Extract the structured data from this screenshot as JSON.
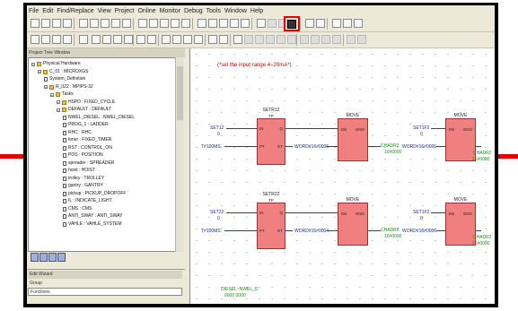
{
  "menubar": {
    "items": [
      "File",
      "Edit",
      "Find/Replace",
      "View",
      "Project",
      "Online",
      "Monitor",
      "Debug",
      "Tools",
      "Window",
      "Help"
    ]
  },
  "toolbar_icons": [
    "new-icon",
    "open-icon",
    "save-icon",
    "print-icon",
    "cut-icon",
    "copy-icon",
    "paste-icon",
    "undo-icon",
    "redo-icon",
    "find-icon",
    "zoom-in-icon",
    "zoom-out-icon",
    "monitor-icon",
    "compile-icon",
    "connect-icon",
    "disconnect-icon",
    "highlighted-tool-icon",
    "stop-icon",
    "run-icon"
  ],
  "tree_panel": {
    "title": "Project Tree Window",
    "items": [
      {
        "label": "Physical Hardware",
        "level": 0,
        "kind": "folder"
      },
      {
        "label": "C_01 : MICROXGS",
        "level": 1,
        "kind": "folder"
      },
      {
        "label": "System_Definition",
        "level": 2,
        "kind": "file"
      },
      {
        "label": "R_022 : MPIPS-32",
        "level": 2,
        "kind": "folder"
      },
      {
        "label": "Tasks",
        "level": 3,
        "kind": "folder"
      },
      {
        "label": "HSPD : FIXED_CYCLE",
        "level": 4,
        "kind": "folder"
      },
      {
        "label": "DEFAULT : DEFAULT",
        "level": 4,
        "kind": "folder"
      },
      {
        "label": "NWEL_DIESEL : NWEL_DIESEL",
        "level": 5,
        "kind": "file"
      },
      {
        "label": "PROG_1 : LADDER",
        "level": 5,
        "kind": "file"
      },
      {
        "label": "RHC : RHC",
        "level": 5,
        "kind": "file"
      },
      {
        "label": "timer : FIXED_TIMER",
        "level": 5,
        "kind": "file"
      },
      {
        "label": "RST : CONTROL_ON",
        "level": 5,
        "kind": "file"
      },
      {
        "label": "POS : POSITION",
        "level": 5,
        "kind": "file"
      },
      {
        "label": "spreader : SPREADER",
        "level": 5,
        "kind": "file"
      },
      {
        "label": "hoist : HOIST",
        "level": 5,
        "kind": "file"
      },
      {
        "label": "trolley : TROLLEY",
        "level": 5,
        "kind": "file"
      },
      {
        "label": "gantry : GANTRY",
        "level": 5,
        "kind": "file"
      },
      {
        "label": "pickup : PICKUP_DROPOFF",
        "level": 5,
        "kind": "file"
      },
      {
        "label": "IL : INDICATE_LIGHT",
        "level": 5,
        "kind": "file"
      },
      {
        "label": "CMS : CMS",
        "level": 5,
        "kind": "file"
      },
      {
        "label": "ANTI_SWAY : ANTI_SWAY",
        "level": 5,
        "kind": "file"
      },
      {
        "label": "VAHLE : VAHLE_SYSTEM",
        "level": 5,
        "kind": "file"
      }
    ]
  },
  "edit_wizard": {
    "title": "Edit Wizard",
    "group_label": "Group",
    "group_value": "Functions"
  },
  "editor": {
    "comment": "(*set the input range 4~20mA*)",
    "rungs": [
      {
        "tp": {
          "title": "SETR12",
          "type": "TP",
          "pin_in": "IN",
          "pin_q": "Q",
          "pin_pt": "PT",
          "pin_et": "ET"
        },
        "in_var": "SET12",
        "in_val": "0",
        "pt_var": "T#100MS",
        "word_mid": "WORD#16#0006",
        "mv1": {
          "title": "MOVE",
          "pin_en": "EN",
          "pin_eno": "ENO"
        },
        "out1_var": "CHADR2",
        "out1_val": "16#0000",
        "in2_var": "SET1F2",
        "in2_val": "0",
        "word_right": "WORD#16#0006",
        "mv2": {
          "title": "MOVE",
          "pin_en": "EN",
          "pin_eno": "ENO"
        },
        "out2_var": "CHADR2",
        "out2_val": "16#0000"
      },
      {
        "tp": {
          "title": "SETR22",
          "type": "TP",
          "pin_in": "IN",
          "pin_q": "Q",
          "pin_pt": "PT",
          "pin_et": "ET"
        },
        "in_var": "SET22",
        "in_val": "0",
        "pt_var": "T#100MS",
        "word_mid": "WORD#16#0004",
        "mv1": {
          "title": "MOVE",
          "pin_en": "EN",
          "pin_eno": "ENO"
        },
        "out1_var": "CHADR2",
        "out1_val": "16#0000",
        "in2_var": "SET1F2",
        "in2_val": "0",
        "word_right": "WORD#16#0006",
        "mv2": {
          "title": "MOVE",
          "pin_en": "EN",
          "pin_eno": "ENO"
        },
        "out2_var": "CHADR2",
        "out2_val": "16#0000"
      }
    ],
    "bottom_var": "DIESEL~NWEL_D",
    "bottom_val": "0000 0000"
  },
  "colors": {
    "highlight": "#e00000",
    "fb_fill": "#f08080",
    "wire": "#2a37b0",
    "comment": "#d00000",
    "output": "#1a8f1a"
  }
}
